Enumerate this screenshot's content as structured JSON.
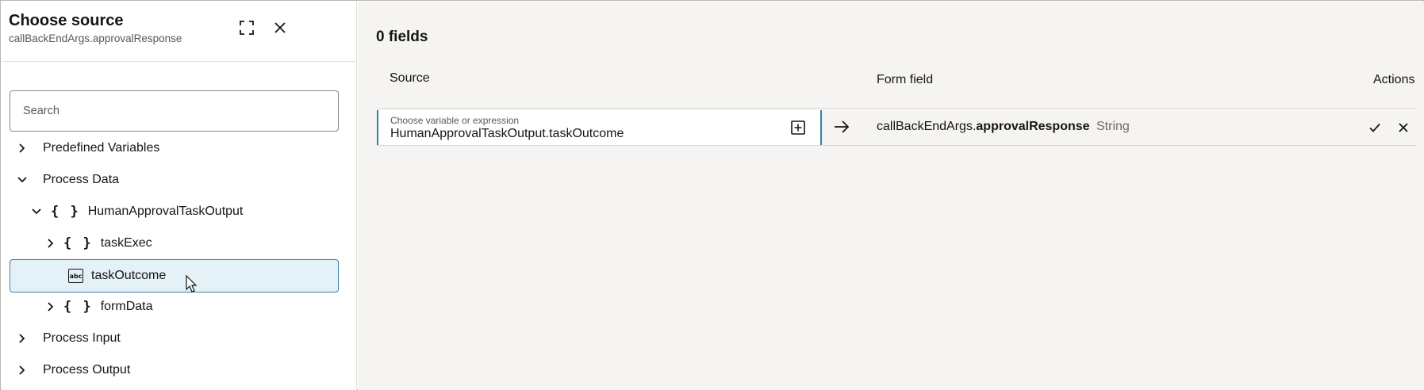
{
  "panel": {
    "title": "Choose source",
    "subtitle": "callBackEndArgs.approvalResponse",
    "icons": {
      "expand": "expand-icon",
      "close": "close-icon"
    }
  },
  "search": {
    "placeholder": "Search",
    "value": ""
  },
  "tree": {
    "predefined": "Predefined Variables",
    "process_data": "Process Data",
    "human_task_output": "HumanApprovalTaskOutput",
    "task_exec": "taskExec",
    "task_outcome": "taskOutcome",
    "form_data": "formData",
    "process_input": "Process Input",
    "process_output": "Process Output",
    "object_glyph": "{ }",
    "string_glyph": "abc"
  },
  "mapping": {
    "fields_count": "0 fields",
    "headers": {
      "source": "Source",
      "form_field": "Form field",
      "actions": "Actions"
    },
    "row": {
      "source_label": "Choose variable or expression",
      "source_value": "HumanApprovalTaskOutput.taskOutcome",
      "target_prefix": "callBackEndArgs.",
      "target_name": "approvalResponse",
      "target_type": "String"
    }
  },
  "colors": {
    "accent": "#3a7ea8",
    "selected_bg": "#e4f1f7",
    "right_bg": "#f5f4f2"
  }
}
